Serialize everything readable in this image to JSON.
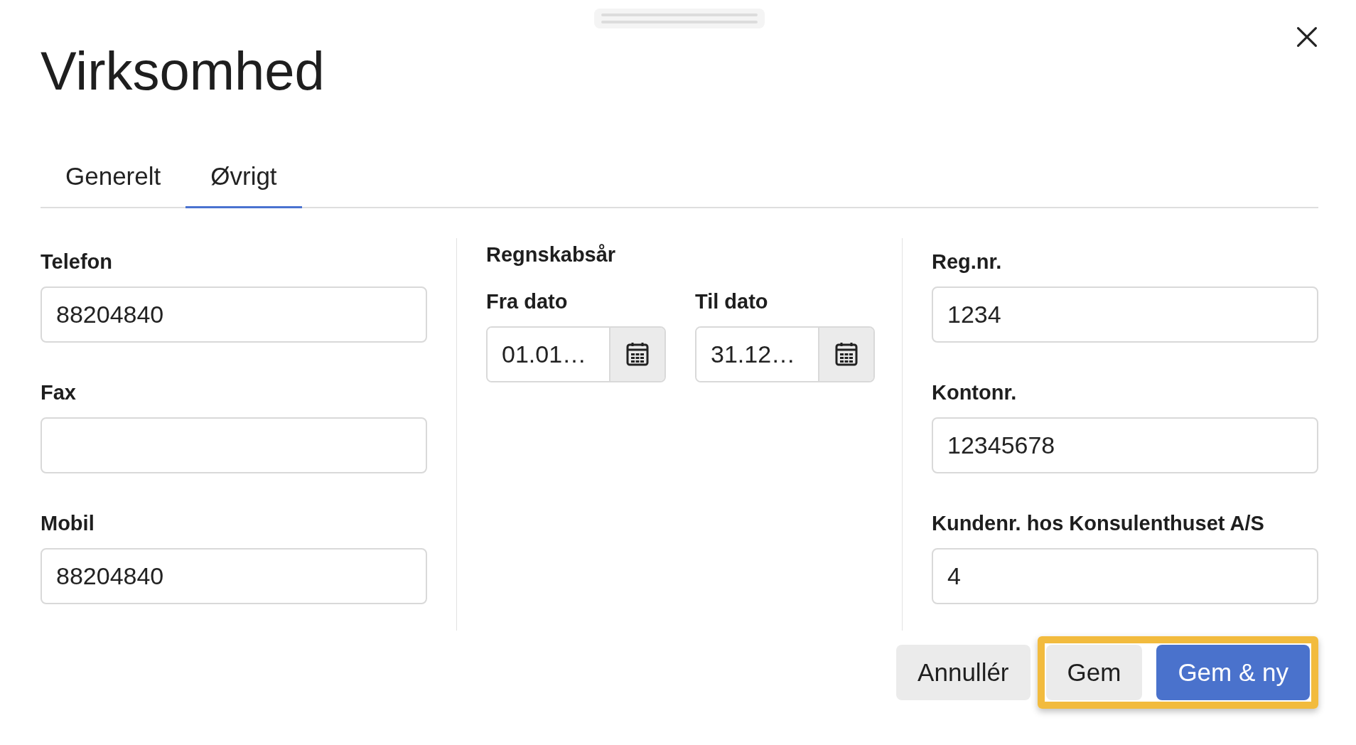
{
  "dialog": {
    "title": "Virksomhed"
  },
  "tabs": [
    {
      "label": "Generelt",
      "selected": false
    },
    {
      "label": "Øvrigt",
      "selected": true
    }
  ],
  "left_fields": [
    {
      "label": "Telefon",
      "value": "88204840"
    },
    {
      "label": "Fax"
    },
    {
      "label": "Mobil",
      "value": "88204840"
    }
  ],
  "fiscal_year": {
    "heading": "Regnskabsår",
    "dates": [
      {
        "label": "Fra dato",
        "value": "01.01…"
      },
      {
        "label": "Til dato",
        "value": "31.12…"
      }
    ]
  },
  "right_fields": [
    {
      "label": "Reg.nr.",
      "value": "1234"
    },
    {
      "label": "Kontonr.",
      "value": "12345678"
    },
    {
      "label": "Kundenr. hos Konsulenthuset A/S",
      "value": "4"
    }
  ],
  "buttons": [
    {
      "label": "Annullér",
      "kind": "secondary",
      "highlighted": false
    },
    {
      "label": "Gem",
      "kind": "secondary",
      "highlighted": true
    },
    {
      "label": "Gem & ny",
      "kind": "primary",
      "highlighted": true
    }
  ]
}
